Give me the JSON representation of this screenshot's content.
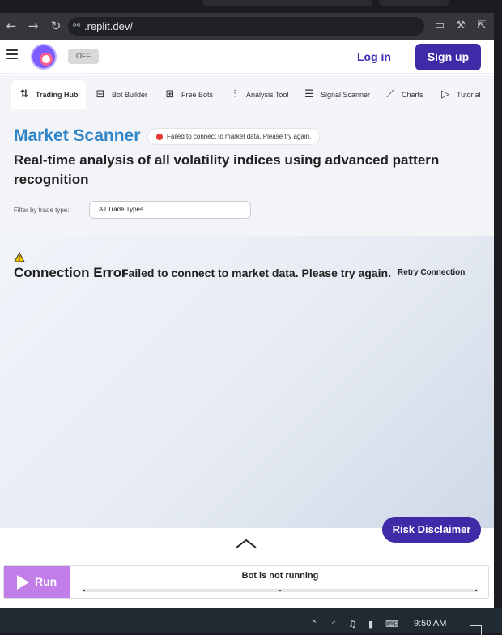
{
  "browser": {
    "url": ".replit.dev/",
    "icons": {
      "back": "back-arrow-icon",
      "forward": "forward-arrow-icon",
      "reload": "reload-icon",
      "site_info": "link-icon",
      "devices": "devices-icon",
      "tools": "wrench-icon",
      "open_external": "open-external-icon"
    }
  },
  "header": {
    "toggle_label": "OFF",
    "login_label": "Log in",
    "signup_label": "Sign up"
  },
  "nav_tabs": [
    {
      "label": "Trading Hub",
      "icon": "swap-arrows-icon",
      "active": true
    },
    {
      "label": "Bot Builder",
      "icon": "bot-builder-icon",
      "active": false
    },
    {
      "label": "Free Bots",
      "icon": "grid-plus-icon",
      "active": false
    },
    {
      "label": "Analysis Tool",
      "icon": "sliders-icon",
      "active": false
    },
    {
      "label": "Signal Scanner",
      "icon": "list-icon",
      "active": false
    },
    {
      "label": "Charts",
      "icon": "line-chart-icon",
      "active": false
    },
    {
      "label": "Tutorial",
      "icon": "play-box-icon",
      "active": false
    }
  ],
  "scanner": {
    "title": "Market Scanner",
    "status_badge": "Failed to connect to market data. Please try again.",
    "subtitle": "Real-time analysis of all volatility indices using advanced pattern recognition",
    "filter_label": "Filter by trade type:",
    "filter_value": "All Trade Types"
  },
  "error": {
    "heading": "Connection Error",
    "message": "Failed to connect to market data. Please try again.",
    "retry_label": "Retry Connection"
  },
  "bottom": {
    "risk_label": "Risk Disclaimer",
    "run_label": "Run",
    "status": "Bot is not running"
  },
  "taskbar": {
    "time": "9:50 AM"
  },
  "colors": {
    "brand": "#3f2aa8",
    "title_blue": "#2e86c8",
    "run_purple": "#c27ee8",
    "error_dot": "#e53935"
  }
}
